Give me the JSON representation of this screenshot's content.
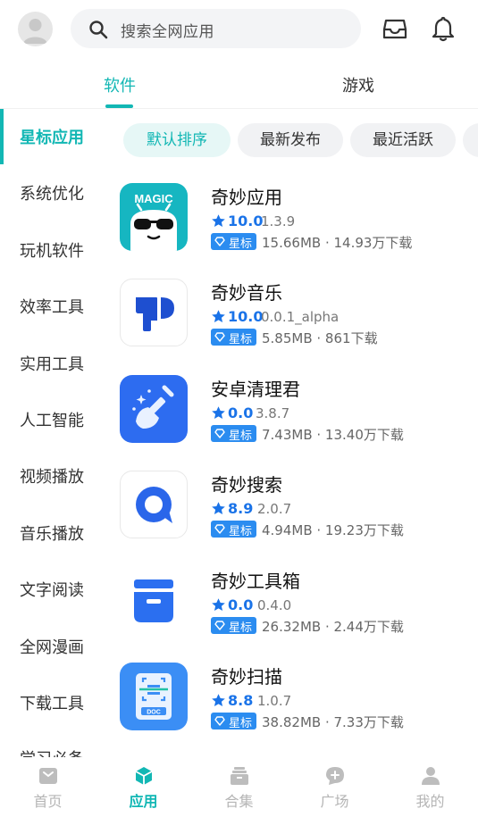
{
  "header": {
    "search_placeholder": "搜索全网应用"
  },
  "tabs": [
    {
      "label": "软件",
      "active": true
    },
    {
      "label": "游戏",
      "active": false
    }
  ],
  "sidebar": {
    "items": [
      {
        "label": "星标应用",
        "active": true
      },
      {
        "label": "系统优化"
      },
      {
        "label": "玩机软件"
      },
      {
        "label": "效率工具"
      },
      {
        "label": "实用工具"
      },
      {
        "label": "人工智能"
      },
      {
        "label": "视频播放"
      },
      {
        "label": "音乐播放"
      },
      {
        "label": "文字阅读"
      },
      {
        "label": "全网漫画"
      },
      {
        "label": "下载工具"
      },
      {
        "label": "学习必备"
      }
    ]
  },
  "sort_chips": [
    {
      "label": "默认排序",
      "active": true
    },
    {
      "label": "最新发布"
    },
    {
      "label": "最近活跃"
    }
  ],
  "apps": [
    {
      "name": "奇妙应用",
      "rating": "10.0",
      "version": "1.3.9",
      "badge": "星标",
      "meta": "15.66MB · 14.93万下载",
      "icon": "magic-icon"
    },
    {
      "name": "奇妙音乐",
      "rating": "10.0",
      "version": "0.0.1_alpha",
      "badge": "星标",
      "meta": "5.85MB · 861下载",
      "icon": "music-logo-icon"
    },
    {
      "name": "安卓清理君",
      "rating": "0.0",
      "version": "3.8.7",
      "badge": "星标",
      "meta": "7.43MB · 13.40万下载",
      "icon": "broom-icon"
    },
    {
      "name": "奇妙搜索",
      "rating": "8.9",
      "version": "2.0.7",
      "badge": "星标",
      "meta": "4.94MB · 19.23万下载",
      "icon": "search-logo-icon"
    },
    {
      "name": "奇妙工具箱",
      "rating": "0.0",
      "version": "0.4.0",
      "badge": "星标",
      "meta": "26.32MB · 2.44万下载",
      "icon": "toolbox-icon"
    },
    {
      "name": "奇妙扫描",
      "rating": "8.8",
      "version": "1.0.7",
      "badge": "星标",
      "meta": "38.82MB · 7.33万下载",
      "icon": "scan-icon"
    }
  ],
  "icon_text": {
    "magic": "MAGIC",
    "doc": "DOC"
  },
  "bottom_nav": [
    {
      "label": "首页",
      "icon": "home-icon"
    },
    {
      "label": "应用",
      "icon": "cube-icon",
      "active": true
    },
    {
      "label": "合集",
      "icon": "collection-icon"
    },
    {
      "label": "广场",
      "icon": "chat-icon"
    },
    {
      "label": "我的",
      "icon": "user-icon"
    }
  ],
  "colors": {
    "accent": "#12b7b4",
    "rating": "#1a73e8",
    "badge": "#2b8cf0"
  }
}
